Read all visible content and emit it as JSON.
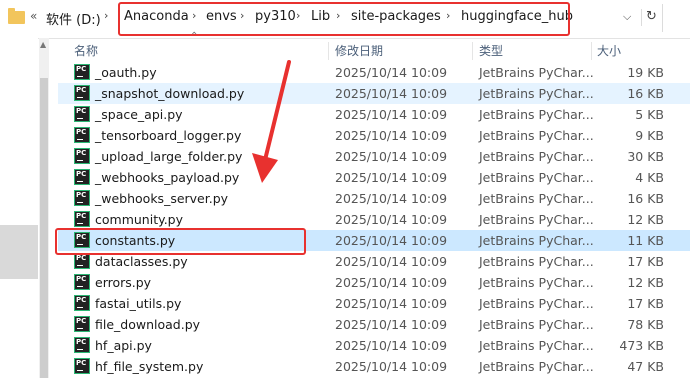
{
  "address_bar": {
    "overflow_chevron": "«",
    "drive": "软件 (D:)",
    "path": [
      "Anaconda",
      "envs",
      "py310",
      "Lib",
      "site-packages",
      "huggingface_hub"
    ],
    "separator": "›",
    "dropdown_glyph": "⌵",
    "refresh_glyph": "↻"
  },
  "columns": {
    "name": "名称",
    "date": "修改日期",
    "type": "类型",
    "size": "大小"
  },
  "files": [
    {
      "name": "_oauth.py",
      "date": "2025/10/14 10:09",
      "type": "JetBrains PyChar...",
      "size": "19 KB"
    },
    {
      "name": "_snapshot_download.py",
      "date": "2025/10/14 10:09",
      "type": "JetBrains PyChar...",
      "size": "16 KB"
    },
    {
      "name": "_space_api.py",
      "date": "2025/10/14 10:09",
      "type": "JetBrains PyChar...",
      "size": "5 KB"
    },
    {
      "name": "_tensorboard_logger.py",
      "date": "2025/10/14 10:09",
      "type": "JetBrains PyChar...",
      "size": "9 KB"
    },
    {
      "name": "_upload_large_folder.py",
      "date": "2025/10/14 10:09",
      "type": "JetBrains PyChar...",
      "size": "30 KB"
    },
    {
      "name": "_webhooks_payload.py",
      "date": "2025/10/14 10:09",
      "type": "JetBrains PyChar...",
      "size": "4 KB"
    },
    {
      "name": "_webhooks_server.py",
      "date": "2025/10/14 10:09",
      "type": "JetBrains PyChar...",
      "size": "16 KB"
    },
    {
      "name": "community.py",
      "date": "2025/10/14 10:09",
      "type": "JetBrains PyChar...",
      "size": "12 KB"
    },
    {
      "name": "constants.py",
      "date": "2025/10/14 10:09",
      "type": "JetBrains PyChar...",
      "size": "11 KB"
    },
    {
      "name": "dataclasses.py",
      "date": "2025/10/14 10:09",
      "type": "JetBrains PyChar...",
      "size": "17 KB"
    },
    {
      "name": "errors.py",
      "date": "2025/10/14 10:09",
      "type": "JetBrains PyChar...",
      "size": "12 KB"
    },
    {
      "name": "fastai_utils.py",
      "date": "2025/10/14 10:09",
      "type": "JetBrains PyChar...",
      "size": "17 KB"
    },
    {
      "name": "file_download.py",
      "date": "2025/10/14 10:09",
      "type": "JetBrains PyChar...",
      "size": "78 KB"
    },
    {
      "name": "hf_api.py",
      "date": "2025/10/14 10:09",
      "type": "JetBrains PyChar...",
      "size": "473 KB"
    },
    {
      "name": "hf_file_system.py",
      "date": "2025/10/14 10:09",
      "type": "JetBrains PyChar...",
      "size": "47 KB"
    }
  ],
  "file_icon_glyph": "PC",
  "hovered_file": "_snapshot_download.py",
  "selected_file": "constants.py",
  "annotation_color": "#e8312f",
  "selection_color": "#cce8ff",
  "hover_color": "#e5f3ff"
}
